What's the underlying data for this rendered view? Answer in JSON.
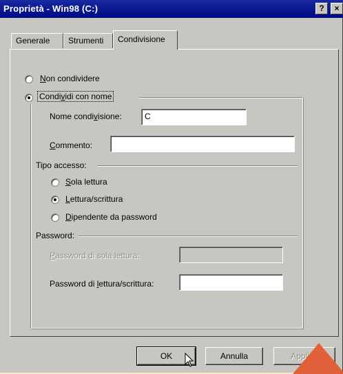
{
  "window": {
    "title": "Proprietà - Win98 (C:)",
    "help_glyph": "?",
    "close_glyph": "×"
  },
  "tabs": [
    {
      "label": "Generale",
      "active": false
    },
    {
      "label": "Strumenti",
      "active": false
    },
    {
      "label": "Condivisione",
      "active": true
    }
  ],
  "sharing": {
    "radio_no_share": {
      "pre": "",
      "accel": "N",
      "post": "on condividere",
      "selected": false
    },
    "radio_share_as": {
      "pre": "Condi",
      "accel": "v",
      "post": "idi con nome",
      "selected": true
    },
    "share_name": {
      "pre": "Nome condi",
      "accel": "v",
      "post": "isione:",
      "value": "C"
    },
    "comment": {
      "pre": "",
      "accel": "C",
      "post": "ommento:",
      "value": ""
    },
    "access_type": {
      "label": "Tipo accesso:",
      "options": [
        {
          "pre": "",
          "accel": "S",
          "post": "ola lettura",
          "selected": false
        },
        {
          "pre": "",
          "accel": "L",
          "post": "ettura/scrittura",
          "selected": true
        },
        {
          "pre": "",
          "accel": "D",
          "post": "ipendente da password",
          "selected": false
        }
      ]
    },
    "passwords": {
      "label": "Password:",
      "read_only": {
        "pre": "",
        "accel": "P",
        "post": "assword di sola lettura:",
        "value": "",
        "enabled": false
      },
      "full": {
        "pre": "Password di ",
        "accel": "l",
        "post": "ettura/scrittura:",
        "value": "",
        "enabled": true
      }
    }
  },
  "buttons": {
    "ok": "OK",
    "cancel": "Annulla",
    "apply": "Applica"
  },
  "colors": {
    "titlebar": "#000a86",
    "face": "#c8c6c0",
    "background": "#f4e7c8",
    "badge": "#e0603a"
  }
}
